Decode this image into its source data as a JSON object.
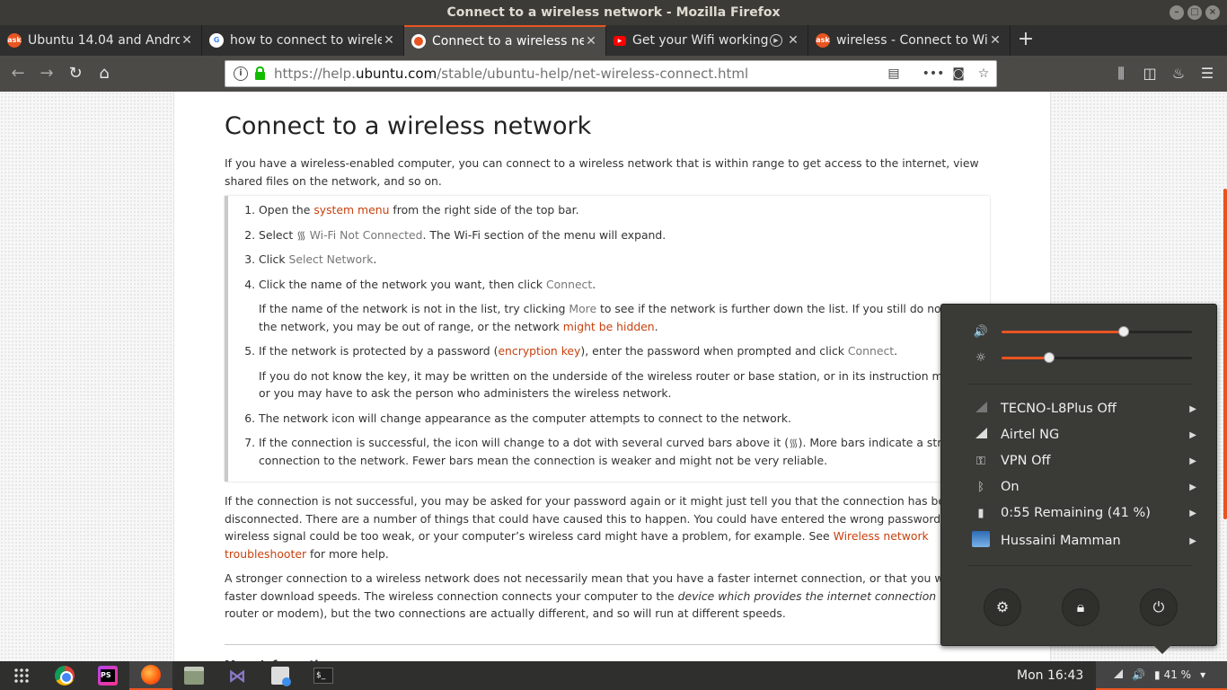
{
  "window": {
    "title": "Connect to a wireless network - Mozilla Firefox"
  },
  "tabs": [
    {
      "label": "Ubuntu 14.04 and Andro",
      "favicon": "ask-ubuntu-icon",
      "favicon_text": "ask",
      "favicon_color": "#e95420"
    },
    {
      "label": "how to connect to wirele",
      "favicon": "google-icon",
      "favicon_text": "G",
      "favicon_color": "#ffffff"
    },
    {
      "label": "Connect to a wireless ne",
      "favicon": "ubuntu-icon",
      "favicon_text": "",
      "favicon_color": "#e95420",
      "active": true
    },
    {
      "label": "Get your Wifi working",
      "favicon": "youtube-icon",
      "favicon_text": "▶",
      "favicon_color": "#ff0000"
    },
    {
      "label": "wireless - Connect to Wi",
      "favicon": "ask-ubuntu-icon",
      "favicon_text": "ask",
      "favicon_color": "#e95420"
    }
  ],
  "urlbar": {
    "url_prefix": "https://help.",
    "url_domain": "ubuntu.com",
    "url_path": "/stable/ubuntu-help/net-wireless-connect.html"
  },
  "article": {
    "title": "Connect to a wireless network",
    "intro": "If you have a wireless-enabled computer, you can connect to a wireless network that is within range to get access to the internet, view shared files on the network, and so on.",
    "step1_a": "Open the ",
    "step1_link": "system menu",
    "step1_b": " from the right side of the top bar.",
    "step2_a": "Select ",
    "step2_gui": "Wi-Fi Not Connected",
    "step2_b": ". The Wi-Fi section of the menu will expand.",
    "step3_a": "Click ",
    "step3_gui": "Select Network",
    "step3_b": ".",
    "step4_a": "Click the name of the network you want, then click ",
    "step4_gui": "Connect",
    "step4_b": ".",
    "step4_note_a": "If the name of the network is not in the list, try clicking ",
    "step4_note_gui": "More",
    "step4_note_b": " to see if the network is further down the list. If you still do not see the network, you may be out of range, or the network ",
    "step4_note_link": "might be hidden",
    "step4_note_c": ".",
    "step5_a": "If the network is protected by a password (",
    "step5_link": "encryption key",
    "step5_b": "), enter the password when prompted and click ",
    "step5_gui": "Connect",
    "step5_c": ".",
    "step5_note": "If you do not know the key, it may be written on the underside of the wireless router or base station, or in its instruction manual, or you may have to ask the person who administers the wireless network.",
    "step6": "The network icon will change appearance as the computer attempts to connect to the network.",
    "step7_a": "If the connection is successful, the icon will change to a dot with several curved bars above it (",
    "step7_b": "). More bars indicate a stronger connection to the network. Fewer bars mean the connection is weaker and might not be very reliable.",
    "para2_a": "If the connection is not successful, you may be asked for your password again or it might just tell you that the connection has been disconnected. There are a number of things that could have caused this to happen. You could have entered the wrong password, the wireless signal could be too weak, or your computer’s wireless card might have a problem, for example. See ",
    "para2_link": "Wireless network troubleshooter",
    "para2_b": " for more help.",
    "para3_a": "A stronger connection to a wireless network does not necessarily mean that you have a faster internet connection, or that you will have faster download speeds. The wireless connection connects your computer to the ",
    "para3_em": "device which provides the internet connection",
    "para3_b": " (like a router or modem), but the two connections are actually different, and so will run at different speeds.",
    "more_info": "More Information"
  },
  "system_menu": {
    "volume_level": 0.64,
    "brightness_level": 0.25,
    "items": [
      {
        "label": "TECNO-L8Plus Off",
        "icon": "cellular-off-icon"
      },
      {
        "label": "Airtel NG",
        "icon": "cellular-signal-icon"
      },
      {
        "label": "VPN Off",
        "icon": "vpn-key-icon"
      },
      {
        "label": "On",
        "icon": "bluetooth-icon"
      },
      {
        "label": "0:55 Remaining (41 %)",
        "icon": "battery-icon"
      },
      {
        "label": "Hussaini Mamman",
        "icon": "user-avatar-icon"
      }
    ]
  },
  "taskbar": {
    "clock": "Mon 16:43",
    "battery_pct": "41 %"
  },
  "colors": {
    "accent": "#e95420",
    "link": "#c7410e",
    "menu_bg": "#3a3a37"
  }
}
